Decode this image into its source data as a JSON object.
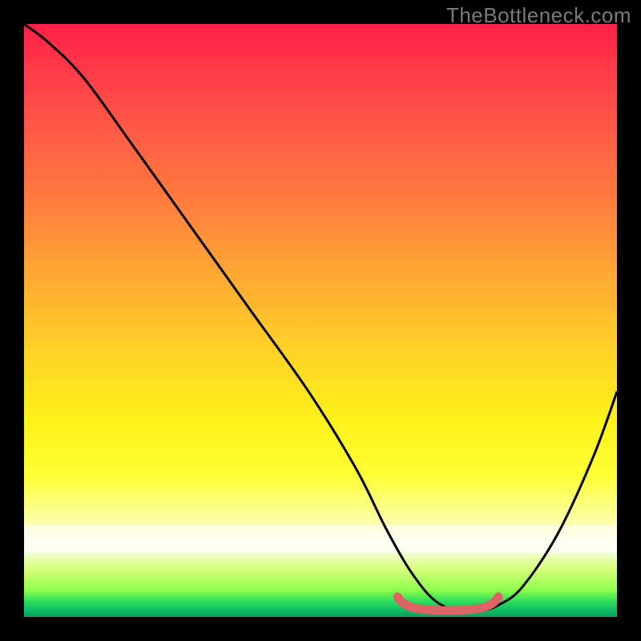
{
  "watermark": "TheBottleneck.com",
  "chart_data": {
    "type": "line",
    "title": "",
    "xlabel": "",
    "ylabel": "",
    "xlim": [
      0,
      100
    ],
    "ylim": [
      0,
      100
    ],
    "grid": false,
    "legend": false,
    "background": {
      "kind": "vertical-gradient",
      "stops": [
        {
          "pos": 0,
          "color": "#ff1f46"
        },
        {
          "pos": 18,
          "color": "#ff5a46"
        },
        {
          "pos": 42,
          "color": "#ffa733"
        },
        {
          "pos": 67,
          "color": "#fff21a"
        },
        {
          "pos": 88,
          "color": "#ffffee"
        },
        {
          "pos": 95.5,
          "color": "#8cff4a"
        },
        {
          "pos": 100,
          "color": "#05a05a"
        }
      ]
    },
    "series": [
      {
        "name": "bottleneck-curve",
        "color": "#000000",
        "x": [
          0,
          4,
          10,
          18,
          28,
          38,
          48,
          56,
          61,
          65,
          69,
          73,
          77,
          80,
          84,
          90,
          96,
          100
        ],
        "y": [
          100,
          97,
          91,
          80,
          66,
          52,
          38,
          25,
          15,
          8,
          3,
          1,
          1,
          2,
          5,
          14,
          27,
          38
        ]
      }
    ],
    "highlight_range": {
      "name": "optimal-zone",
      "color": "#de6365",
      "x": [
        63,
        80
      ],
      "y_approx": 1.5
    }
  }
}
